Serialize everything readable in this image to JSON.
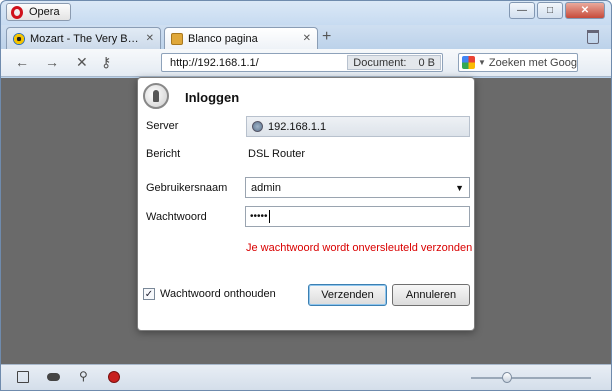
{
  "titlebar": {
    "app_label": "Opera",
    "controls": {
      "minimize": "—",
      "maximize": "□",
      "close": "✕"
    }
  },
  "tabs": [
    {
      "title": "Mozart - The Very Best ...",
      "icon": "radiation-icon",
      "active": false
    },
    {
      "title": "Blanco pagina",
      "icon": "blank-page-icon",
      "active": true
    }
  ],
  "navigation": {
    "back": "←",
    "forward": "→",
    "stop": "✕",
    "key": "⚷"
  },
  "address": {
    "url": "http://192.168.1.1/",
    "document_label": "Document:",
    "document_size": "0 B"
  },
  "search": {
    "placeholder": "Zoeken met Goog"
  },
  "dialog": {
    "title": "Inloggen",
    "server_label": "Server",
    "server_value": "192.168.1.1",
    "message_label": "Bericht",
    "message_value": "DSL Router",
    "username_label": "Gebruikersnaam",
    "username_value": "admin",
    "password_label": "Wachtwoord",
    "password_value": "•••••",
    "warning": "Je wachtwoord wordt onversleuteld verzonden",
    "warning_color": "#d90000",
    "remember_label": "Wachtwoord onthouden",
    "remember_checked": true,
    "submit_label": "Verzenden",
    "cancel_label": "Annuleren"
  },
  "colors": {
    "content_background": "#6a6a6a",
    "chrome": "#b9d1ea"
  }
}
